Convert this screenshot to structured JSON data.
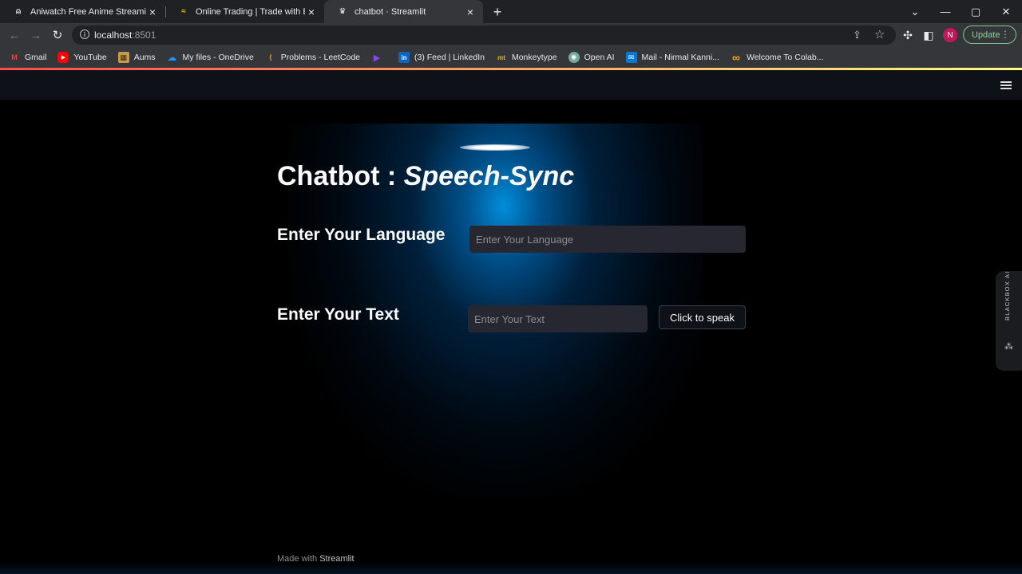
{
  "browser": {
    "tabs": [
      {
        "title": "Aniwatch Free Anime Streaming",
        "favicon": "aniwatch-icon",
        "active": false
      },
      {
        "title": "Online Trading | Trade with Exness",
        "favicon": "exness-icon",
        "active": false
      },
      {
        "title": "chatbot · Streamlit",
        "favicon": "streamlit-icon",
        "active": true
      }
    ],
    "new_tab_label": "+",
    "address": {
      "host": "localhost",
      "port": ":8501"
    },
    "update_label": "Update",
    "profile_initial": "N",
    "accent_update": "#8fd09a"
  },
  "bookmarks": [
    {
      "label": "Gmail",
      "icon": "gmail-icon",
      "color": "#ea4335",
      "glyph": "M"
    },
    {
      "label": "YouTube",
      "icon": "youtube-icon",
      "color": "#ff0000",
      "glyph": "▶"
    },
    {
      "label": "Aums",
      "icon": "aums-icon",
      "color": "#c79a4a",
      "glyph": "▦"
    },
    {
      "label": "My files - OneDrive",
      "icon": "onedrive-icon",
      "color": "#1e90ff",
      "glyph": "☁"
    },
    {
      "label": "Problems - LeetCode",
      "icon": "leetcode-icon",
      "color": "#f0a30a",
      "glyph": "⟨"
    },
    {
      "label": "",
      "icon": "purple-play-icon",
      "color": "#8e44ff",
      "glyph": "▶"
    },
    {
      "label": "(3) Feed | LinkedIn",
      "icon": "linkedin-icon",
      "color": "#0a66c2",
      "glyph": "in"
    },
    {
      "label": "Monkeytype",
      "icon": "monkeytype-icon",
      "color": "#e2b714",
      "glyph": "mt"
    },
    {
      "label": "Open AI",
      "icon": "openai-icon",
      "color": "#74aa9c",
      "glyph": "✺"
    },
    {
      "label": "Mail - Nirmal Kanni...",
      "icon": "outlook-icon",
      "color": "#0078d4",
      "glyph": "✉"
    },
    {
      "label": "Welcome To Colab...",
      "icon": "colab-icon",
      "color": "#f9ab00",
      "glyph": "∞"
    }
  ],
  "app": {
    "title_plain": "Chatbot : ",
    "title_italic": "Speech-Sync",
    "language_label": "Enter Your Language",
    "language_placeholder": "Enter Your Language",
    "language_value": "",
    "text_label": "Enter Your Text",
    "text_placeholder": "Enter Your Text",
    "text_value": "",
    "speak_button": "Click to speak",
    "footer_prefix": "Made with ",
    "footer_brand": "Streamlit",
    "sidebar_widget": "BLACKBOX AI"
  },
  "colors": {
    "page_bg": "#000000",
    "header_bg": "#0e1117",
    "input_bg": "#262730",
    "glow": "#0096e6",
    "text": "#fafafa"
  }
}
